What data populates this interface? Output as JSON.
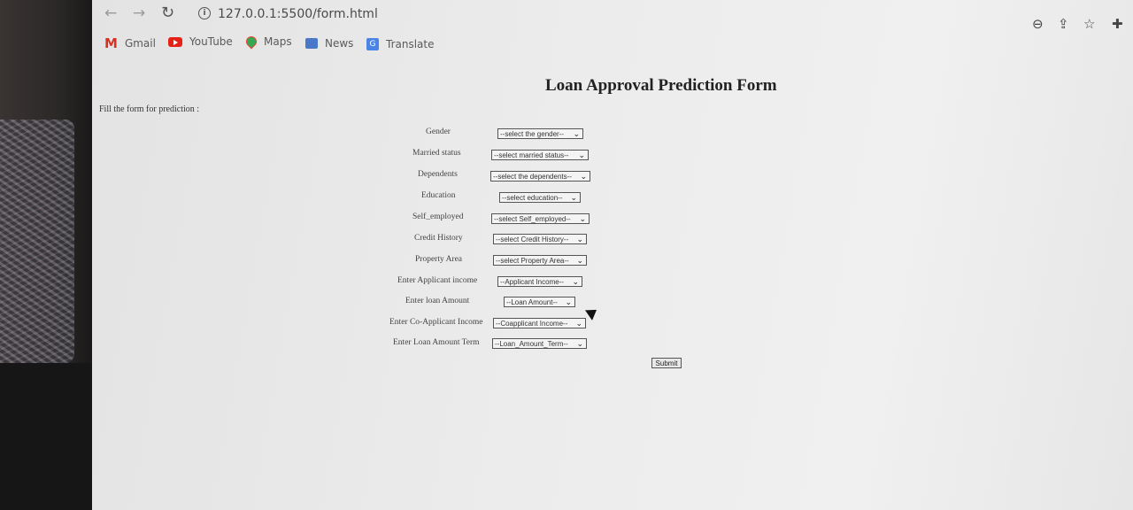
{
  "browser": {
    "url": "127.0.0.1:5500/form.html",
    "bookmarks": [
      {
        "label": "Gmail",
        "icon": "gmail-icon"
      },
      {
        "label": "YouTube",
        "icon": "youtube-icon"
      },
      {
        "label": "Maps",
        "icon": "maps-icon"
      },
      {
        "label": "News",
        "icon": "news-icon"
      },
      {
        "label": "Translate",
        "icon": "translate-icon"
      }
    ]
  },
  "page": {
    "title": "Loan Approval Prediction Form",
    "instruction": "Fill the form for prediction :",
    "fields": [
      {
        "label": "Gender",
        "select": "--select the gender--"
      },
      {
        "label": "Married status",
        "select": "--select married status--"
      },
      {
        "label": "Dependents",
        "select": "--select the dependents--"
      },
      {
        "label": "Education",
        "select": "--select education--"
      },
      {
        "label": "Self_employed",
        "select": "--select Self_employed--"
      },
      {
        "label": "Credit History",
        "select": "--select Credit History--"
      },
      {
        "label": "Property Area",
        "select": "--select Property Area--"
      },
      {
        "label": "Enter Applicant income",
        "select": "--Applicant Income--"
      },
      {
        "label": "Enter loan Amount",
        "select": "--Loan Amount--"
      },
      {
        "label": "Enter Co-Applicant Income",
        "select": "--Coapplicant Income--"
      },
      {
        "label": "Enter Loan Amount Term",
        "select": "--Loan_Amount_Term--"
      }
    ],
    "submit_label": "Submit"
  }
}
